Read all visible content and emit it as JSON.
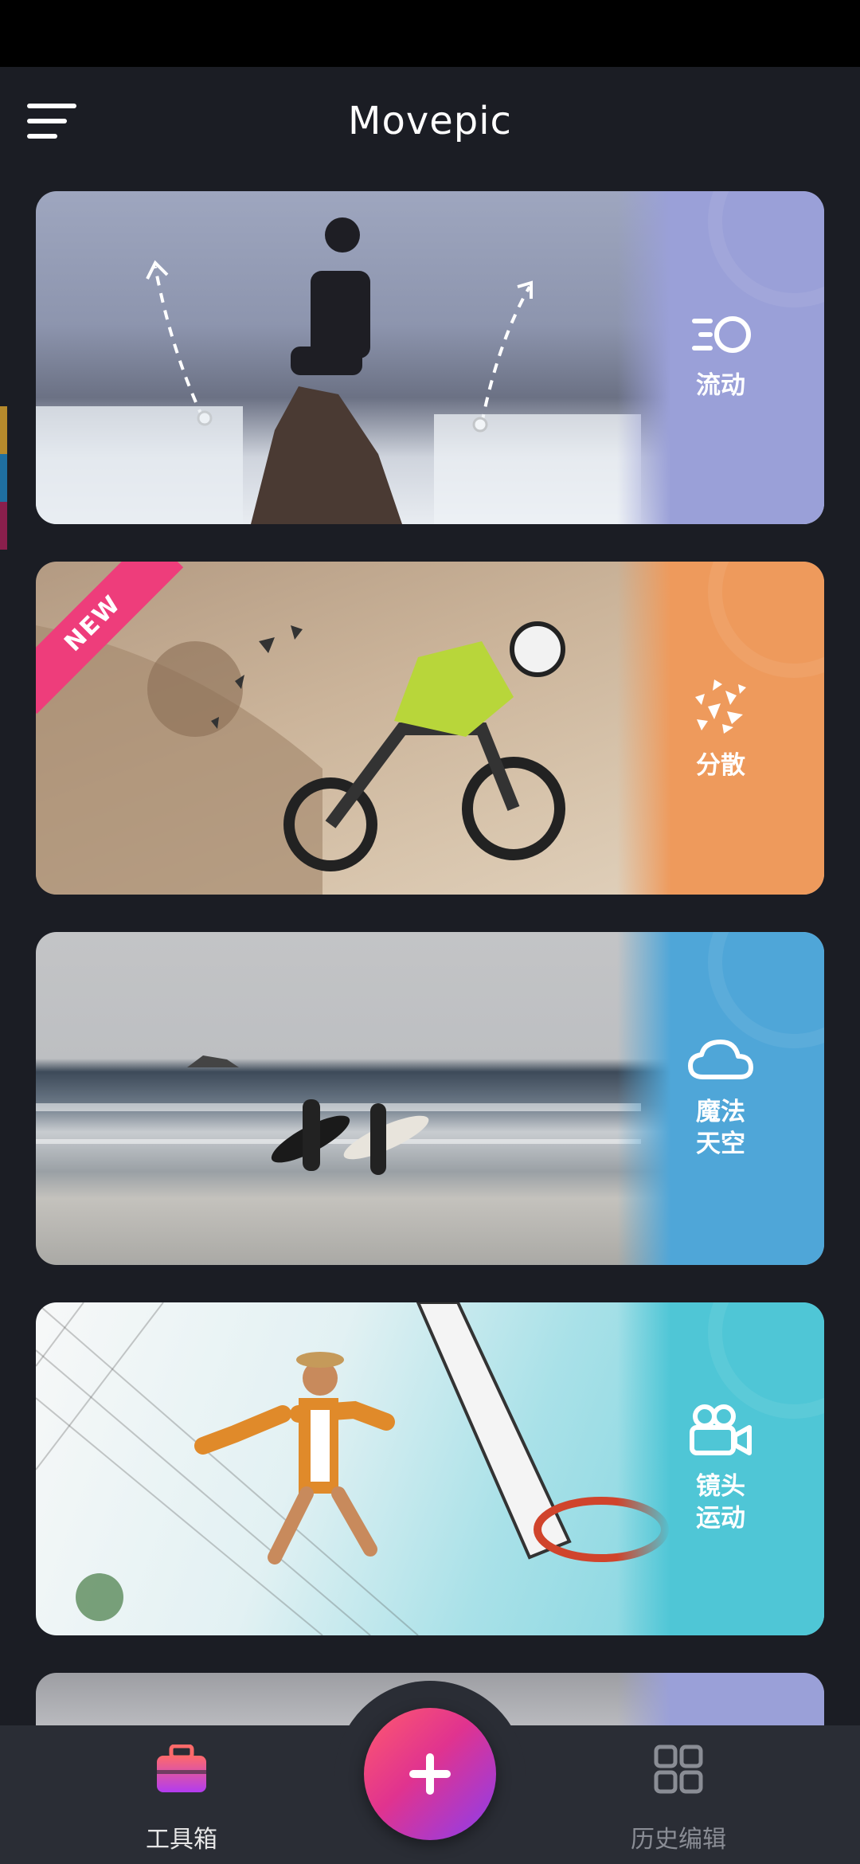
{
  "app": {
    "title": "Movepic"
  },
  "colors": {
    "background": "#1b1d24",
    "nav_background": "#2a2d35",
    "fab_gradient": [
      "#ff5a6e",
      "#e0338f",
      "#8a3ef0"
    ],
    "new_badge": "#ee3d7b",
    "side_tabs": [
      "#b68a2c",
      "#1f6fa0",
      "#8a1f4c"
    ]
  },
  "cards": [
    {
      "label": "流动",
      "icon": "flow-icon",
      "accent": "#9aa0d8",
      "badge": ""
    },
    {
      "label": "分散",
      "icon": "dispersion-icon",
      "accent": "#ee9a5c",
      "badge": "NEW"
    },
    {
      "label": "魔法\n天空",
      "icon": "cloud-icon",
      "accent": "#4fa6d8",
      "badge": ""
    },
    {
      "label": "镜头\n运动",
      "icon": "video-camera-icon",
      "accent": "#4fc6d6",
      "badge": ""
    }
  ],
  "bottom_nav": {
    "left": {
      "label": "工具箱",
      "icon": "toolbox-icon"
    },
    "center": {
      "icon": "plus-icon"
    },
    "right": {
      "label": "历史编辑",
      "icon": "grid-icon"
    }
  }
}
